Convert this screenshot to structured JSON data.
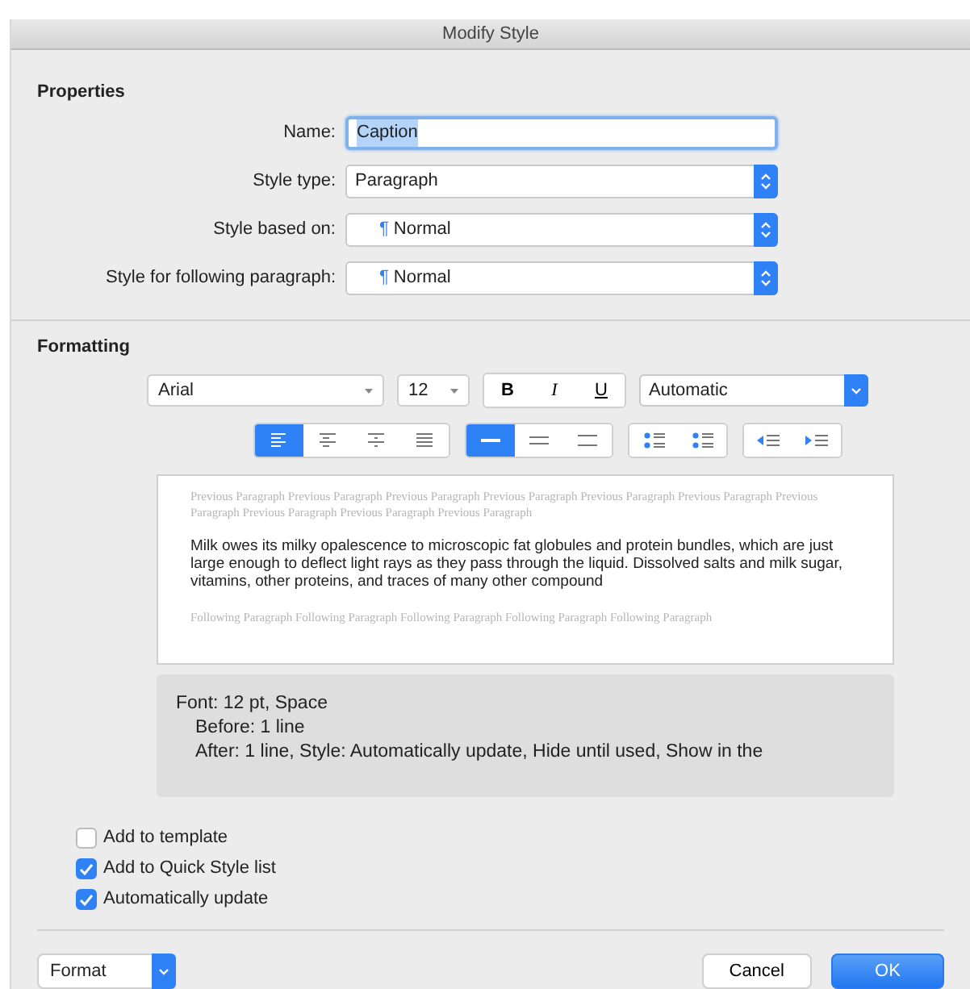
{
  "window": {
    "title": "Modify Style"
  },
  "properties": {
    "heading": "Properties",
    "fields": [
      {
        "kind": "text",
        "label": "Name:",
        "value": "Caption",
        "focused": true
      },
      {
        "kind": "select",
        "label": "Style type:",
        "value": "Paragraph"
      },
      {
        "kind": "select",
        "label": "Style based on:",
        "mark": "¶",
        "value": "Normal"
      },
      {
        "kind": "select",
        "label": "Style for following paragraph:",
        "mark": "¶",
        "value": "Normal"
      }
    ]
  },
  "formatting": {
    "heading": "Formatting",
    "font": "Arial",
    "size": "12",
    "style_buttons": [
      {
        "label": "B",
        "kind": "bold"
      },
      {
        "label": "I",
        "kind": "italic"
      },
      {
        "label": "U",
        "kind": "underline"
      }
    ],
    "color_menu": "Automatic",
    "groups": [
      [
        {
          "kind": "align-left",
          "selected": true
        },
        {
          "kind": "align-center",
          "selected": false
        },
        {
          "kind": "align-right",
          "selected": false
        },
        {
          "kind": "justify",
          "selected": false
        }
      ],
      [
        {
          "kind": "single",
          "selected": true
        },
        {
          "kind": "one-half",
          "selected": false
        },
        {
          "kind": "double",
          "selected": false
        }
      ],
      [
        {
          "kind": "space-less",
          "selected": false
        },
        {
          "kind": "space-more",
          "selected": false
        }
      ],
      [
        {
          "kind": "outdent",
          "selected": false
        },
        {
          "kind": "indent",
          "selected": false
        }
      ]
    ]
  },
  "preview": {
    "previous": "Previous Paragraph Previous Paragraph Previous Paragraph Previous Paragraph Previous Paragraph Previous Paragraph Previous Paragraph Previous Paragraph Previous Paragraph Previous Paragraph",
    "sample": "Milk owes its milky opalescence to microscopic fat globules and protein bundles, which are just large enough to deflect light rays as they pass through the liquid. Dissolved salts and milk sugar, vitamins, other proteins, and traces of many other compound",
    "following": "Following Paragraph Following Paragraph Following Paragraph Following Paragraph Following Paragraph"
  },
  "description": [
    {
      "kind": "head",
      "text": "Font: 12 pt, Space"
    },
    {
      "kind": "sub",
      "text": "Before:  1 line"
    },
    {
      "kind": "sub",
      "text": "After:  1 line, Style: Automatically update, Hide until used, Show in the"
    }
  ],
  "options": [
    {
      "label": "Add to template",
      "checked": false
    },
    {
      "label": "Add to Quick Style list",
      "checked": true
    },
    {
      "label": "Automatically update",
      "checked": true
    }
  ],
  "footer": {
    "menu": "Format",
    "buttons": [
      {
        "label": "Cancel",
        "default": false
      },
      {
        "label": "OK",
        "default": true
      }
    ]
  }
}
